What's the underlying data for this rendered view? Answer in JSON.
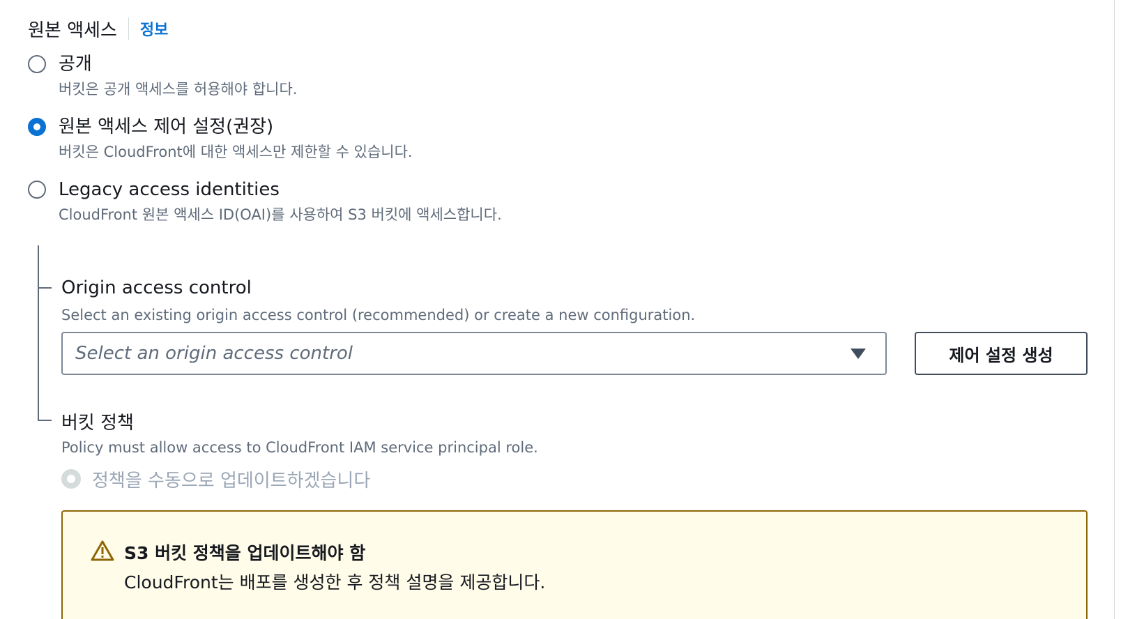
{
  "section": {
    "title": "원본 액세스",
    "info_link": "정보"
  },
  "origin_access_options": [
    {
      "label": "공개",
      "description": "버킷은 공개 액세스를 허용해야 합니다.",
      "selected": false
    },
    {
      "label": "원본 액세스 제어 설정(권장)",
      "description": "버킷은 CloudFront에 대한 액세스만 제한할 수 있습니다.",
      "selected": true
    },
    {
      "label": "Legacy access identities",
      "description": "CloudFront 원본 액세스 ID(OAI)를 사용하여 S3 버킷에 액세스합니다.",
      "selected": false
    }
  ],
  "origin_access_control": {
    "label": "Origin access control",
    "description": "Select an existing origin access control (recommended) or create a new configuration.",
    "select_placeholder": "Select an origin access control",
    "create_button_label": "제어 설정 생성"
  },
  "bucket_policy": {
    "label": "버킷 정책",
    "description": "Policy must allow access to CloudFront IAM service principal role.",
    "option_label": "정책을 수동으로 업데이트하겠습니다",
    "option_disabled": true
  },
  "alert": {
    "type": "warning",
    "icon": "warning-icon",
    "title": "S3 버킷 정책을 업데이트해야 함",
    "message": "CloudFront는 배포를 생성한 후 정책 설명을 제공합니다."
  },
  "colors": {
    "accent": "#0972d3",
    "text": "#16191f",
    "secondary_text": "#5f6b7a",
    "disabled_text": "#9ba7b6",
    "warning_background": "#fffce9",
    "warning_border": "#8d6605"
  }
}
